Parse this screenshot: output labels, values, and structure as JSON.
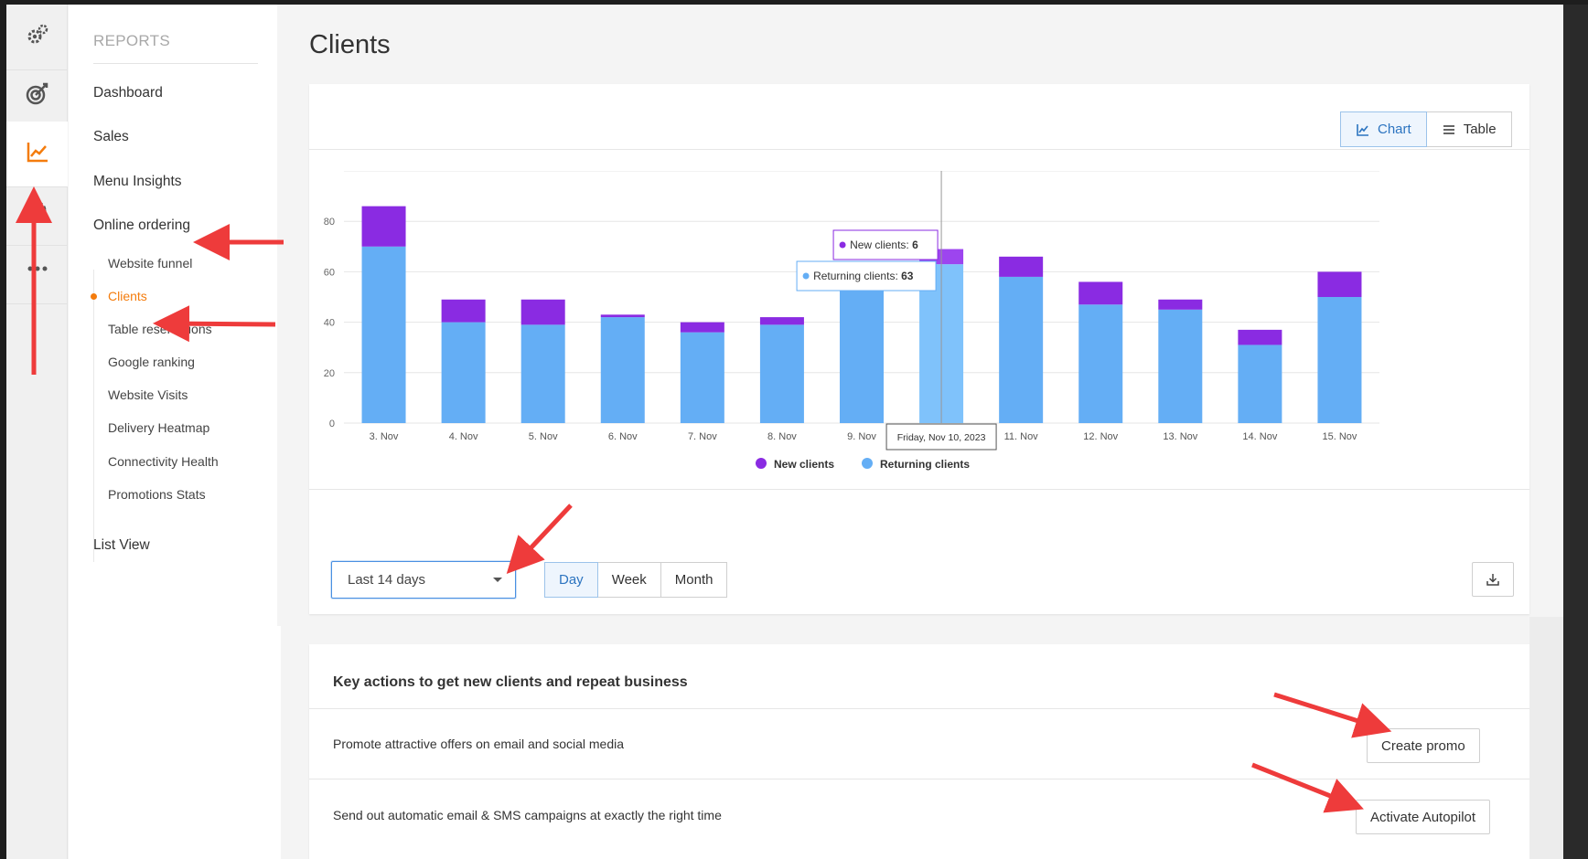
{
  "sidebar": {
    "heading": "REPORTS",
    "main_items": [
      {
        "label": "Dashboard"
      },
      {
        "label": "Sales"
      },
      {
        "label": "Menu Insights"
      },
      {
        "label": "Online ordering"
      },
      {
        "label": "List View"
      }
    ],
    "sub_items": [
      {
        "label": "Website funnel"
      },
      {
        "label": "Clients",
        "active": true
      },
      {
        "label": "Table reservations"
      },
      {
        "label": "Google ranking"
      },
      {
        "label": "Website Visits"
      },
      {
        "label": "Delivery Heatmap"
      },
      {
        "label": "Connectivity Health"
      },
      {
        "label": "Promotions Stats"
      }
    ]
  },
  "rail_icons": [
    "gears-icon",
    "target-icon",
    "line-chart-icon",
    "gear-icon",
    "more-icon"
  ],
  "page": {
    "title": "Clients"
  },
  "view_toggle": {
    "chart_label": "Chart",
    "table_label": "Table"
  },
  "chart_data": {
    "type": "bar",
    "stacked": true,
    "categories": [
      "3. Nov",
      "4. Nov",
      "5. Nov",
      "6. Nov",
      "7. Nov",
      "8. Nov",
      "9. Nov",
      "10. Nov",
      "11. Nov",
      "12. Nov",
      "13. Nov",
      "14. Nov",
      "15. Nov"
    ],
    "series": [
      {
        "name": "Returning clients",
        "color": "#64aef5",
        "values": [
          70,
          40,
          39,
          42,
          36,
          39,
          63,
          63,
          58,
          47,
          45,
          31,
          50
        ]
      },
      {
        "name": "New clients",
        "color": "#8a2be2",
        "values": [
          16,
          9,
          10,
          1,
          4,
          3,
          0,
          6,
          8,
          9,
          4,
          6,
          10
        ]
      }
    ],
    "y_ticks": [
      0,
      20,
      40,
      60,
      80
    ],
    "ylim": [
      0,
      100
    ],
    "grid": true,
    "legend": "bottom-center",
    "hover_index": 7,
    "tooltip": {
      "new_label": "New clients:",
      "new_value": "6",
      "returning_label": "Returning clients:",
      "returning_value": "63",
      "date_label": "Friday, Nov 10, 2023"
    }
  },
  "controls": {
    "range_value": "Last 14 days",
    "periods": [
      {
        "label": "Day",
        "active": true
      },
      {
        "label": "Week"
      },
      {
        "label": "Month"
      }
    ]
  },
  "actions": {
    "title": "Key actions to get new clients and repeat business",
    "rows": [
      {
        "text": "Promote attractive offers on email and social media",
        "button": "Create promo"
      },
      {
        "text": "Send out automatic email & SMS campaigns at exactly the right time",
        "button": "Activate Autopilot"
      }
    ]
  },
  "colors": {
    "accent_orange": "#f47c0d",
    "accent_blue": "#2c74c0",
    "annotation_red": "#ee3b3b"
  }
}
